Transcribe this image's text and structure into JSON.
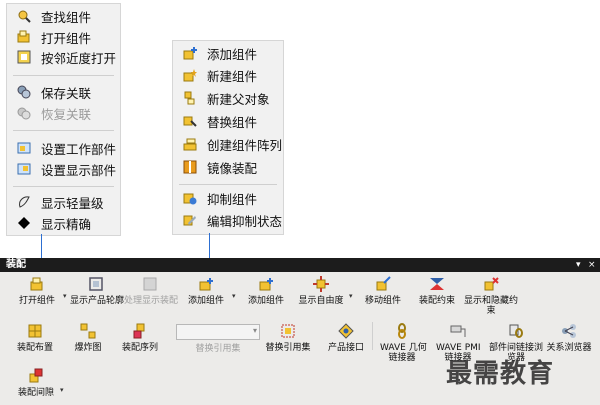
{
  "menu_left": {
    "items": [
      {
        "label": "查找组件",
        "icon": "find-component-icon"
      },
      {
        "label": "打开组件",
        "icon": "open-component-icon"
      },
      {
        "label": "按邻近度打开",
        "icon": "open-by-proximity-icon"
      },
      {
        "label": "保存关联",
        "icon": "save-association-icon"
      },
      {
        "label": "恢复关联",
        "icon": "restore-association-icon"
      },
      {
        "label": "设置工作部件",
        "icon": "set-work-part-icon"
      },
      {
        "label": "设置显示部件",
        "icon": "set-display-part-icon"
      },
      {
        "label": "显示轻量级",
        "icon": "show-lightweight-icon"
      },
      {
        "label": "显示精确",
        "icon": "show-exact-icon"
      }
    ]
  },
  "menu_right": {
    "items": [
      {
        "label": "添加组件",
        "icon": "add-component-icon"
      },
      {
        "label": "新建组件",
        "icon": "new-component-icon"
      },
      {
        "label": "新建父对象",
        "icon": "new-parent-icon"
      },
      {
        "label": "替换组件",
        "icon": "replace-component-icon"
      },
      {
        "label": "创建组件阵列",
        "icon": "component-array-icon"
      },
      {
        "label": "镜像装配",
        "icon": "mirror-assembly-icon"
      },
      {
        "label": "抑制组件",
        "icon": "suppress-component-icon"
      },
      {
        "label": "编辑抑制状态",
        "icon": "edit-suppression-icon"
      }
    ]
  },
  "toolbar": {
    "title": "装配",
    "close_glyph": "×",
    "menu_glyph": "▾",
    "row1": [
      {
        "label": "打开组件"
      },
      {
        "label": "显示产品轮廓"
      },
      {
        "label": "处理显示装配"
      },
      {
        "label": "添加组件"
      },
      {
        "label": "添加组件"
      },
      {
        "label": "显示自由度"
      },
      {
        "label": "移动组件"
      },
      {
        "label": "装配约束"
      },
      {
        "label": "显示和隐藏约"
      },
      {
        "label": "束"
      }
    ],
    "row2": [
      {
        "label": "装配布置"
      },
      {
        "label": "爆炸图"
      },
      {
        "label": "装配序列"
      },
      {
        "label": "替换引用集"
      },
      {
        "label": "替换引用集"
      },
      {
        "label": "产品接口"
      },
      {
        "label": "WAVE 几何"
      },
      {
        "label": "链接器"
      },
      {
        "label": "WAVE PMI"
      },
      {
        "label": "链接器"
      },
      {
        "label": "部件间链接浏"
      },
      {
        "label": "览器"
      },
      {
        "label": "关系浏览器"
      }
    ],
    "row3": [
      {
        "label": "装配间隙"
      }
    ]
  },
  "watermark": "最需教育",
  "colors": {
    "accent": "#2d6fd1",
    "titlebar": "#1c1c1c",
    "panel": "#ecebe9",
    "menu": "#f1f1f1"
  }
}
